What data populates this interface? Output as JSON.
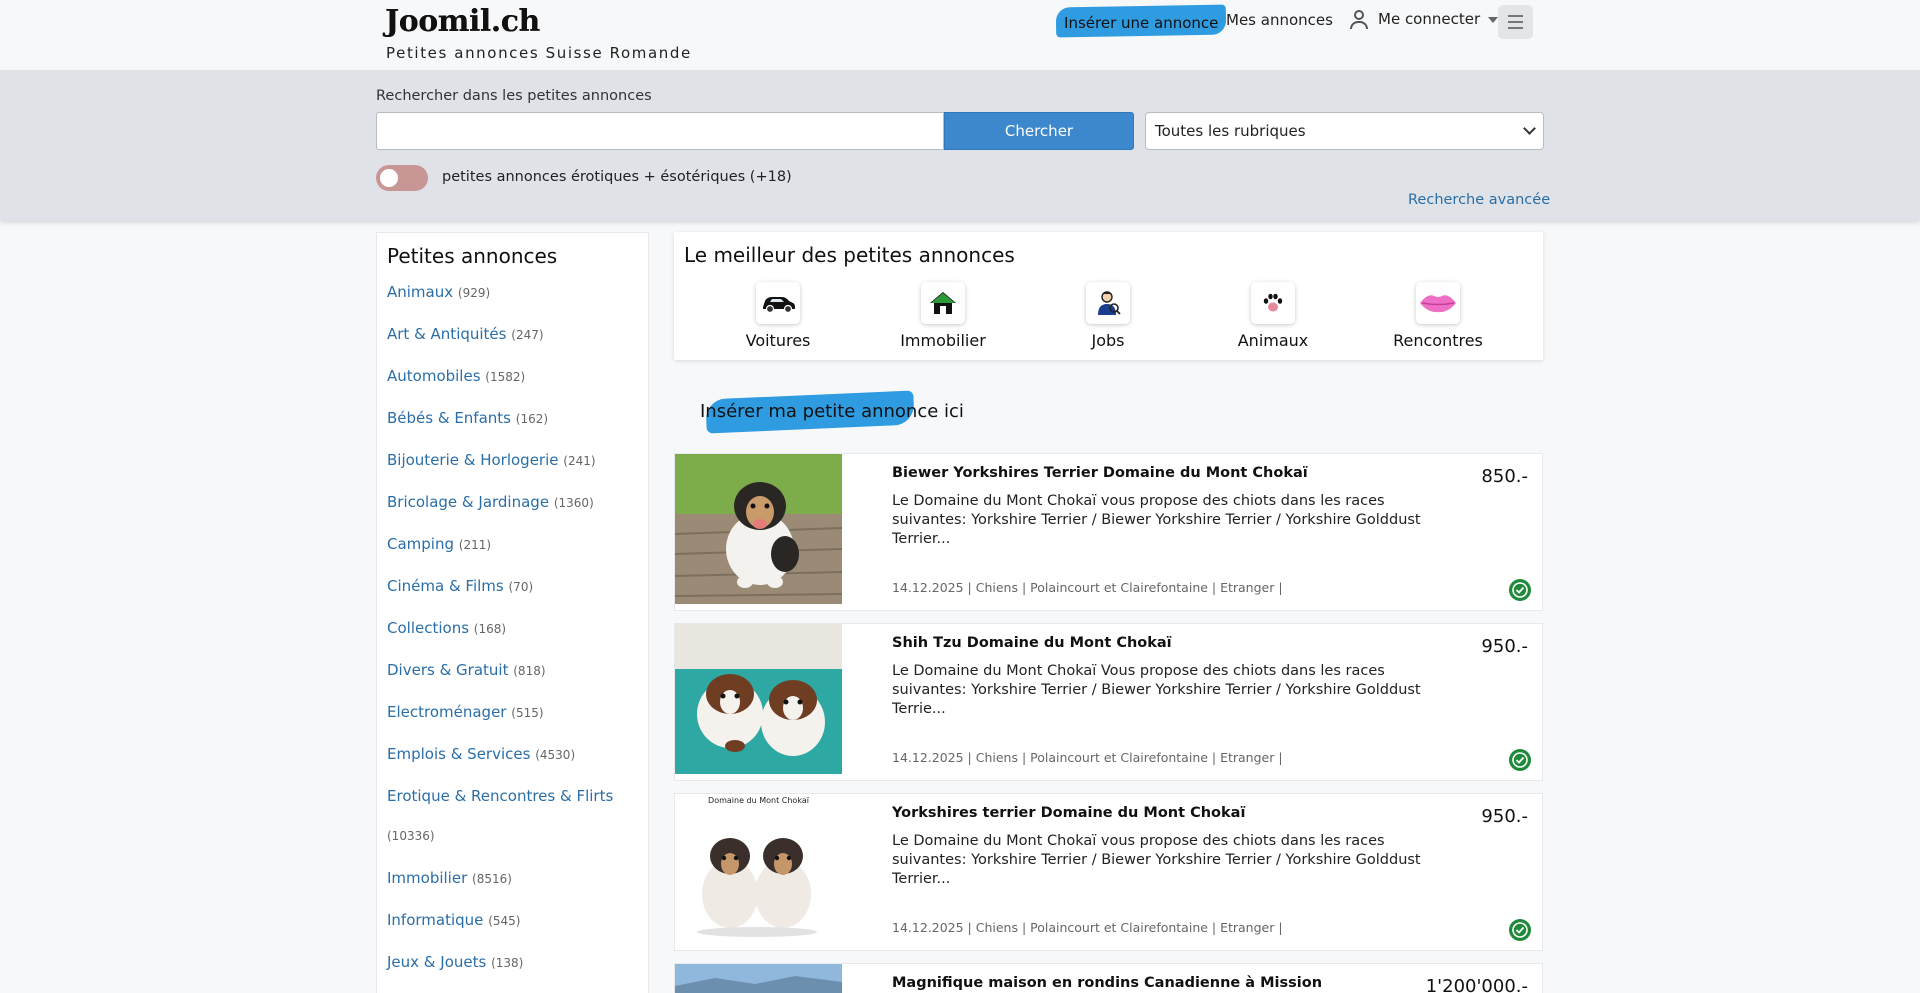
{
  "header": {
    "logo": "Joomil.ch",
    "tagline": "Petites annonces Suisse Romande",
    "insert_label": "Insérer une annonce",
    "my_ads_label": "Mes annonces",
    "login_label": "Me connecter",
    "user_icon": "user-icon",
    "menu_icon": "hamburger-icon"
  },
  "search": {
    "label": "Rechercher dans les petites annonces",
    "input_value": "",
    "button_label": "Chercher",
    "rubric_selected": "Toutes les rubriques",
    "toggle_label": "petites annonces érotiques + ésotériques (+18)",
    "toggle_on": false,
    "advanced_label": "Recherche avancée"
  },
  "sidebar": {
    "title": "Petites annonces",
    "categories": [
      {
        "label": "Animaux",
        "count": "(929)"
      },
      {
        "label": "Art & Antiquités",
        "count": "(247)"
      },
      {
        "label": "Automobiles",
        "count": "(1582)"
      },
      {
        "label": "Bébés & Enfants",
        "count": "(162)"
      },
      {
        "label": "Bijouterie & Horlogerie",
        "count": "(241)"
      },
      {
        "label": "Bricolage & Jardinage",
        "count": "(1360)"
      },
      {
        "label": "Camping",
        "count": "(211)"
      },
      {
        "label": "Cinéma & Films",
        "count": "(70)"
      },
      {
        "label": "Collections",
        "count": "(168)"
      },
      {
        "label": "Divers & Gratuit",
        "count": "(818)"
      },
      {
        "label": "Electroménager",
        "count": "(515)"
      },
      {
        "label": "Emplois & Services",
        "count": "(4530)"
      },
      {
        "label": "Erotique & Rencontres & Flirts",
        "count": "(10336)"
      },
      {
        "label": "Immobilier",
        "count": "(8516)"
      },
      {
        "label": "Informatique",
        "count": "(545)"
      },
      {
        "label": "Jeux & Jouets",
        "count": "(138)"
      }
    ]
  },
  "best": {
    "title": "Le meilleur des petites annonces",
    "items": [
      {
        "label": "Voitures",
        "icon": "car-icon"
      },
      {
        "label": "Immobilier",
        "icon": "house-icon"
      },
      {
        "label": "Jobs",
        "icon": "worker-icon"
      },
      {
        "label": "Animaux",
        "icon": "paw-icon"
      },
      {
        "label": "Rencontres",
        "icon": "lips-icon"
      }
    ]
  },
  "cta_label": "Insérer ma petite annonce ici",
  "listings": [
    {
      "title": "Biewer Yorkshires Terrier Domaine du Mont Chokaï",
      "description": "Le Domaine du Mont Chokaï vous propose des chiots dans les races suivantes: Yorkshire Terrier / Biewer Yorkshire Terrier / Yorkshire Golddust Terrier...",
      "meta": "14.12.2025 | Chiens | Polaincourt et Clairefontaine | Etranger |",
      "price": "850.-"
    },
    {
      "title": "Shih Tzu Domaine du Mont Chokaï",
      "description": "Le Domaine du Mont Chokaï  Vous propose des chiots dans les races suivantes: Yorkshire Terrier / Biewer Yorkshire Terrier / Yorkshire Golddust Terrie...",
      "meta": "14.12.2025 | Chiens | Polaincourt et Clairefontaine | Etranger |",
      "price": "950.-"
    },
    {
      "title": "Yorkshires terrier Domaine du Mont Chokaï",
      "description": "Le Domaine du Mont Chokaï  vous propose des chiots dans les races suivantes: Yorkshire Terrier / Biewer Yorkshire Terrier / Yorkshire Golddust Terrier...",
      "meta": "14.12.2025 | Chiens | Polaincourt et Clairefontaine | Etranger |",
      "price": "950.-",
      "image_caption": "Domaine du Mont Chokaï"
    },
    {
      "title": "Magnifique maison en rondins Canadienne à Mission",
      "description": "",
      "meta": "",
      "price": "1'200'000.-"
    }
  ],
  "colors": {
    "link": "#2a6ea8",
    "accent_blue": "#2f9be0",
    "search_button": "#3d88cd",
    "verified_green": "#1f8a3a"
  }
}
